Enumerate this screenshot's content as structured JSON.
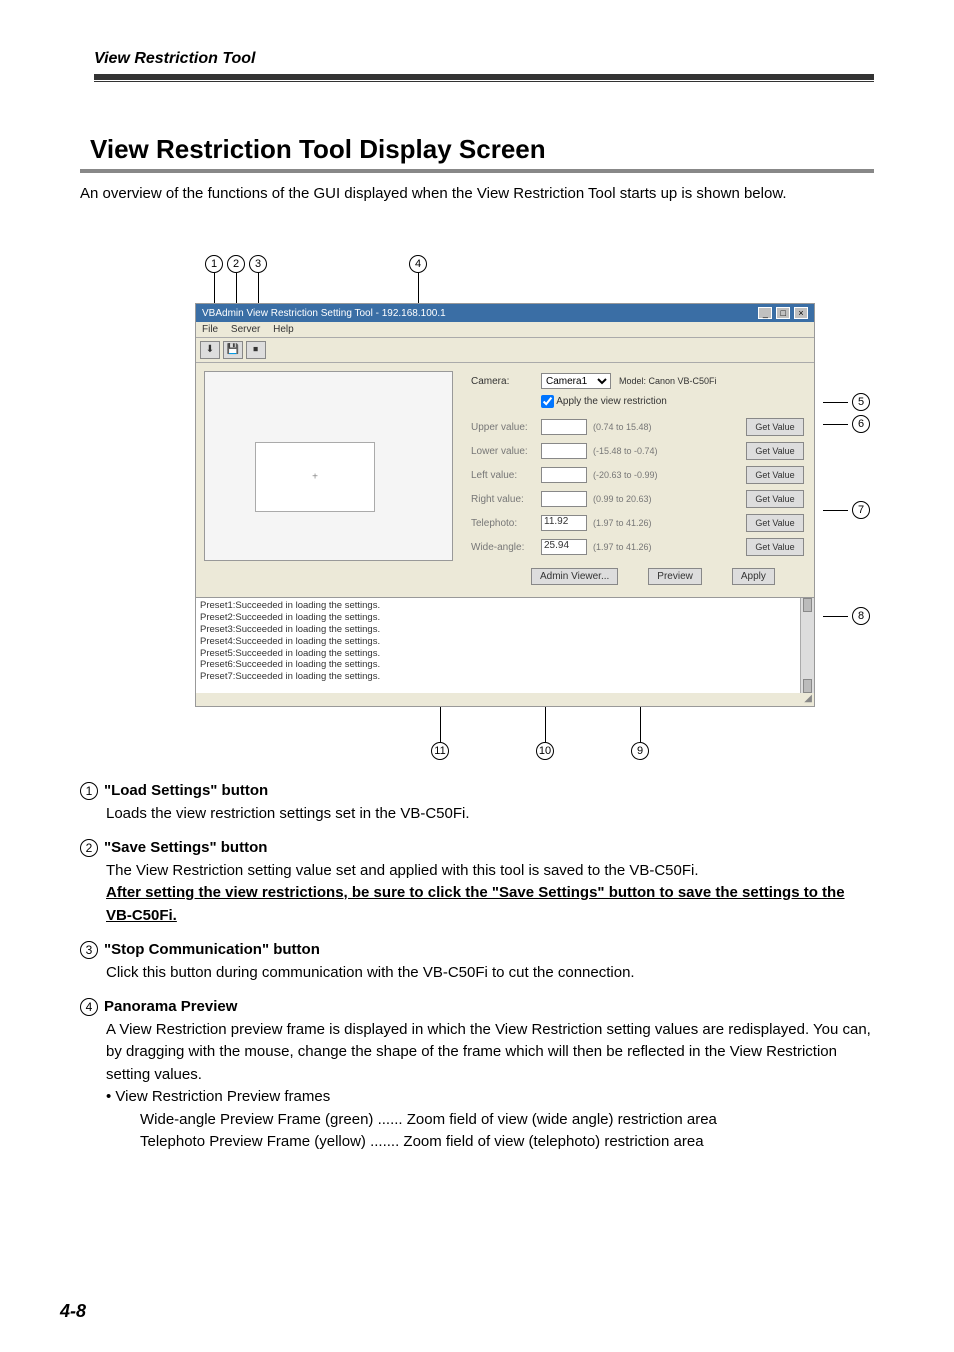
{
  "header": {
    "doc_section": "View Restriction Tool"
  },
  "section": {
    "title": "View Restriction Tool Display Screen",
    "intro": "An overview of the functions of the GUI displayed when the View Restriction Tool starts up is shown below."
  },
  "gui": {
    "window_title": "VBAdmin View Restriction Setting Tool - 192.168.100.1",
    "menus": {
      "file": "File",
      "server": "Server",
      "help": "Help"
    },
    "win_buttons": {
      "min": "_",
      "max": "□",
      "close": "×"
    },
    "toolbar_icons": [
      "⬇",
      "💾",
      "⏹"
    ],
    "camera_label": "Camera:",
    "camera_value": "Camera1",
    "model_label": "Model: Canon VB-C50Fi",
    "apply_checkbox_label": "Apply the view restriction",
    "rows": [
      {
        "label": "Upper value:",
        "value": "",
        "range": "(0.74 to 15.48)",
        "btn": "Get Value"
      },
      {
        "label": "Lower value:",
        "value": "",
        "range": "(-15.48 to -0.74)",
        "btn": "Get Value"
      },
      {
        "label": "Left value:",
        "value": "",
        "range": "(-20.63 to -0.99)",
        "btn": "Get Value"
      },
      {
        "label": "Right value:",
        "value": "",
        "range": "(0.99 to 20.63)",
        "btn": "Get Value"
      },
      {
        "label": "Telephoto:",
        "value": "11.92",
        "range": "(1.97 to 41.26)",
        "btn": "Get Value"
      },
      {
        "label": "Wide-angle:",
        "value": "25.94",
        "range": "(1.97 to 41.26)",
        "btn": "Get Value"
      }
    ],
    "bottom_buttons": {
      "admin": "Admin Viewer...",
      "preview": "Preview",
      "apply": "Apply"
    },
    "log_lines": [
      "Preset1:Succeeded in loading the settings.",
      "Preset2:Succeeded in loading the settings.",
      "Preset3:Succeeded in loading the settings.",
      "Preset4:Succeeded in loading the settings.",
      "Preset5:Succeeded in loading the settings.",
      "Preset6:Succeeded in loading the settings.",
      "Preset7:Succeeded in loading the settings."
    ]
  },
  "callouts": {
    "c1": "1",
    "c2": "2",
    "c3": "3",
    "c4": "4",
    "c5": "5",
    "c6": "6",
    "c7": "7",
    "c8": "8",
    "c9": "9",
    "c10": "10",
    "c11": "11"
  },
  "items": {
    "i1": {
      "title": "\"Load Settings\" button",
      "body": "Loads the view restriction settings set in the VB-C50Fi."
    },
    "i2": {
      "title": "\"Save Settings\" button",
      "body1": "The View Restriction setting value set and applied with this tool is saved to the VB-C50Fi.",
      "body2": "After setting the view restrictions, be sure to click the \"Save Settings\" button to save the settings to the VB-C50Fi."
    },
    "i3": {
      "title": "\"Stop Communication\" button",
      "body": "Click this button during communication with the VB-C50Fi to cut the connection."
    },
    "i4": {
      "title": "Panorama Preview",
      "body": "A View Restriction preview frame is displayed in which the View Restriction setting values are redisplayed. You can, by dragging with the mouse, change the shape of the frame which will then be reflected in the View Restriction setting values.",
      "bullet": "View Restriction Preview frames",
      "sub1": "Wide-angle Preview Frame (green) ...... Zoom field of view (wide angle) restriction area",
      "sub2": "Telephoto Preview Frame (yellow) ....... Zoom field of view (telephoto) restriction area"
    }
  },
  "pagenum": "4-8"
}
